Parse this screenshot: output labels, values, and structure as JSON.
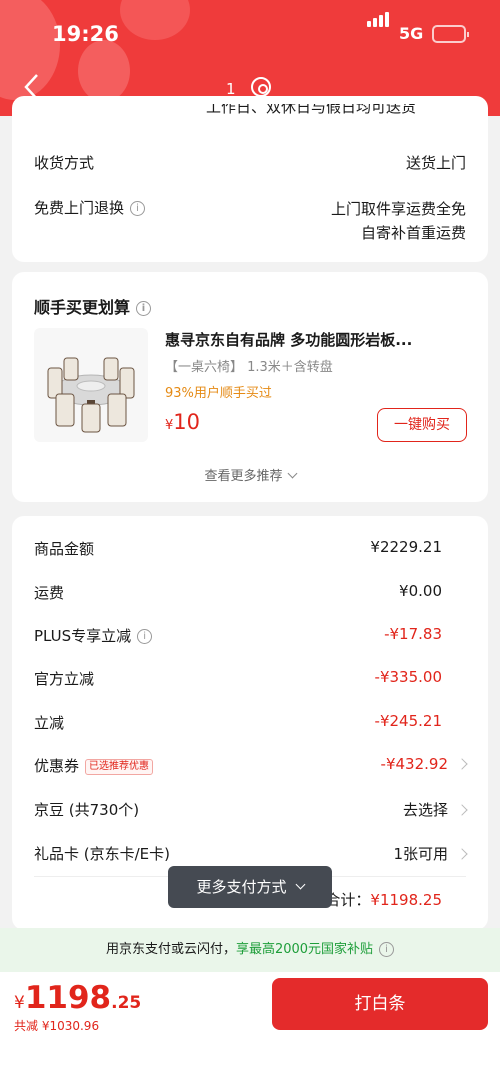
{
  "status_bar": {
    "time": "19:26",
    "network": "5G"
  },
  "nav": {
    "title_number": "1"
  },
  "delivery": {
    "clipped_text": "工作日、双休日与假日均可送货",
    "method_label": "收货方式",
    "method_value": "送货上门",
    "return_label": "免费上门退换",
    "return_value_line1": "上门取件享运费全免",
    "return_value_line2": "自寄补首重运费"
  },
  "recommend": {
    "title": "顺手买更划算",
    "product_name": "惠寻京东自有品牌 多功能圆形岩板...",
    "product_spec": "【一桌六椅】 1.3米＋含转盘",
    "bought_text": "93%用户顺手买过",
    "currency": "¥",
    "price": "10",
    "buy_button": "一键购买",
    "more_link": "查看更多推荐"
  },
  "summary": {
    "rows": [
      {
        "label": "商品金额",
        "value": "¥2229.21"
      },
      {
        "label": "运费",
        "value": "¥0.00"
      },
      {
        "label": "PLUS专享立减",
        "value": "-¥17.83"
      },
      {
        "label": "官方立减",
        "value": "-¥335.00"
      },
      {
        "label": "立减",
        "value": "-¥245.21"
      },
      {
        "label": "优惠券",
        "value": "-¥432.92",
        "tag": "已选推荐优惠"
      },
      {
        "label": "京豆 (共730个)",
        "value": "去选择"
      },
      {
        "label": "礼品卡 (京东卡/E卡)",
        "value": "1张可用"
      }
    ],
    "total_label": "合计：",
    "total_value": "¥1198.25",
    "more_payment": "更多支付方式"
  },
  "banner": {
    "text_prefix": "用京东支付或云闪付，",
    "text_highlight": "享最高2000元国家补贴"
  },
  "footer": {
    "currency": "¥",
    "amount_int": "1198",
    "amount_dec": ".25",
    "saved": "共减 ¥1030.96",
    "pay_button": "打白条"
  },
  "colors": {
    "brand_red": "#ef3b3b",
    "price_red": "#e1251b",
    "subsidy_green": "#1e9e3a"
  }
}
